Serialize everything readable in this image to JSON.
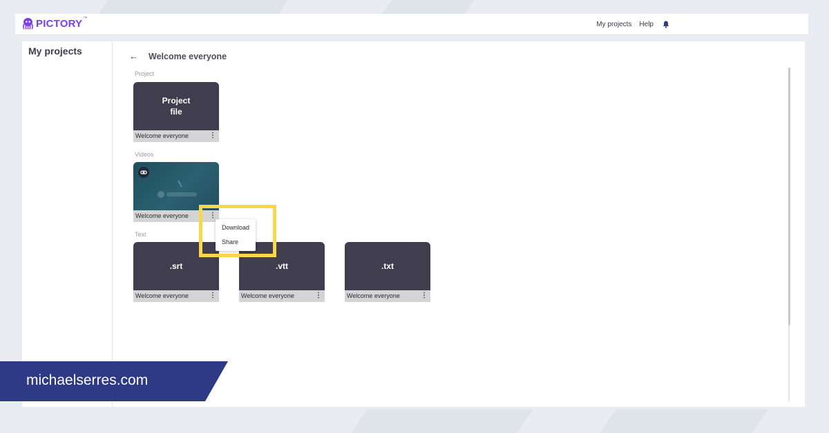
{
  "app": {
    "logo_text": "PICTORY",
    "logo_tm": "™"
  },
  "header": {
    "nav": [
      "My projects",
      "Help"
    ]
  },
  "sidebar": {
    "title": "My projects"
  },
  "project": {
    "back_arrow": "←",
    "title": "Welcome everyone"
  },
  "sections": {
    "project": "Project",
    "videos": "Videos",
    "text": "Text"
  },
  "cards": {
    "project_file": {
      "thumb_line1": "Project",
      "thumb_line2": "file",
      "label": "Welcome everyone"
    },
    "video": {
      "label": "Welcome everyone"
    },
    "srt": {
      "thumb": ".srt",
      "label": "Welcome everyone"
    },
    "vtt": {
      "thumb": ".vtt",
      "label": "Welcome everyone"
    },
    "txt": {
      "thumb": ".txt",
      "label": "Welcome everyone"
    }
  },
  "kebab_glyph": "⋮",
  "context_menu": {
    "items": [
      "Download",
      "Share"
    ]
  },
  "banner": {
    "text": "michaelserres.com"
  },
  "colors": {
    "brand": "#7b3ff2",
    "card": "#3f3d4e",
    "highlight": "#f7d84b",
    "banner": "#2e3a86"
  },
  "icons": [
    "octopus-logo-icon",
    "bell-icon",
    "back-arrow-icon",
    "link-icon",
    "kebab-menu-icon"
  ]
}
